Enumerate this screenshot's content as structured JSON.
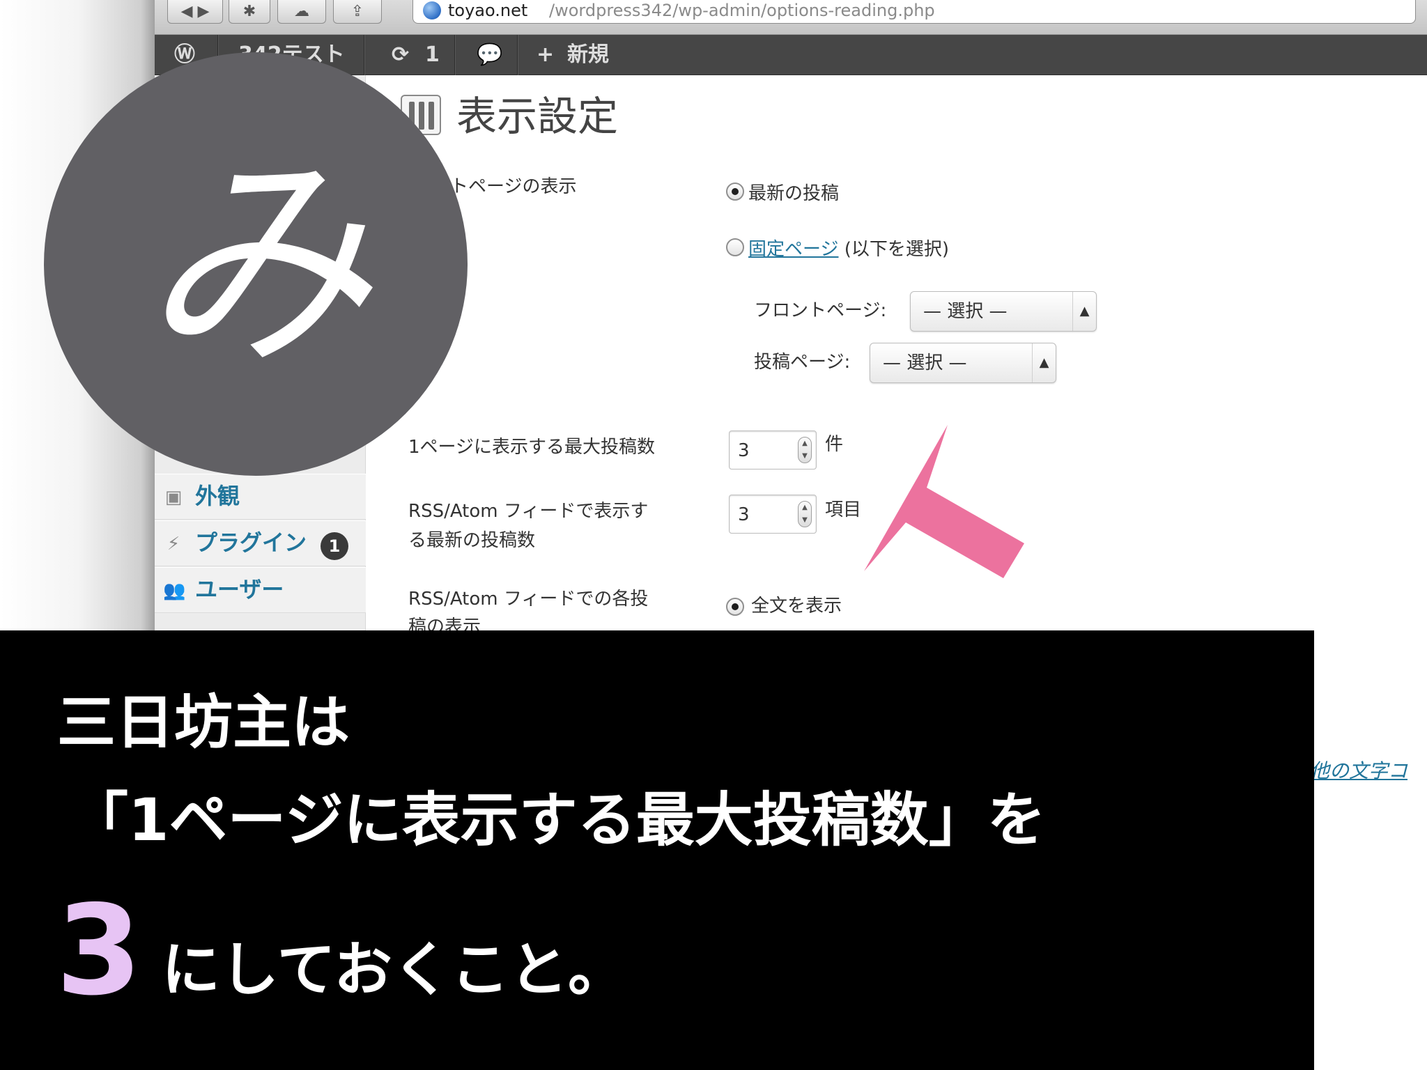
{
  "browser": {
    "url_host": "toyao.net",
    "url_path": "/wordpress342/wp-admin/options-reading.php"
  },
  "admin_bar": {
    "site_name": "342テスト",
    "updates_count": "1",
    "new_label": "新規"
  },
  "sidebar": {
    "items": [
      {
        "label": "外観",
        "icon": "appearance-icon"
      },
      {
        "label": "プラグイン",
        "icon": "plugin-icon",
        "badge": "1"
      },
      {
        "label": "ユーザー",
        "icon": "users-icon"
      }
    ]
  },
  "page": {
    "title": "表示設定",
    "front_page_label": "フロントページの表示",
    "front_page_label_visible": "ントページの表示",
    "options": {
      "latest_posts": "最新の投稿",
      "static_page_link": "固定ページ",
      "static_page_suffix": "(以下を選択)"
    },
    "front_page_select_label": "フロントページ:",
    "front_page_select_value": "— 選択 —",
    "posts_page_select_label": "投稿ページ:",
    "posts_page_select_value": "— 選択 —",
    "posts_per_page_label": "1ページに表示する最大投稿数",
    "posts_per_page_value": "3",
    "posts_per_page_unit": "件",
    "rss_count_label_1": "RSS/Atom フィードで表示す",
    "rss_count_label_2": "る最新の投稿数",
    "rss_count_value": "3",
    "rss_count_unit": "項目",
    "rss_each_label_1": "RSS/Atom フィードでの各投",
    "rss_each_label_2": "稿の表示",
    "full_text_option": "全文を表示",
    "other_link": "他の文字コ"
  },
  "badge": {
    "char": "み"
  },
  "caption": {
    "line1": "三日坊主は",
    "line2": "「1ページに表示する最大投稿数」を",
    "line3_highlight": "3",
    "line3_rest": "にしておくこと。"
  },
  "colors": {
    "badge_bg": "#616064",
    "arrow": "#ec729e",
    "highlight": "#e7c4f4",
    "link": "#21759b"
  }
}
